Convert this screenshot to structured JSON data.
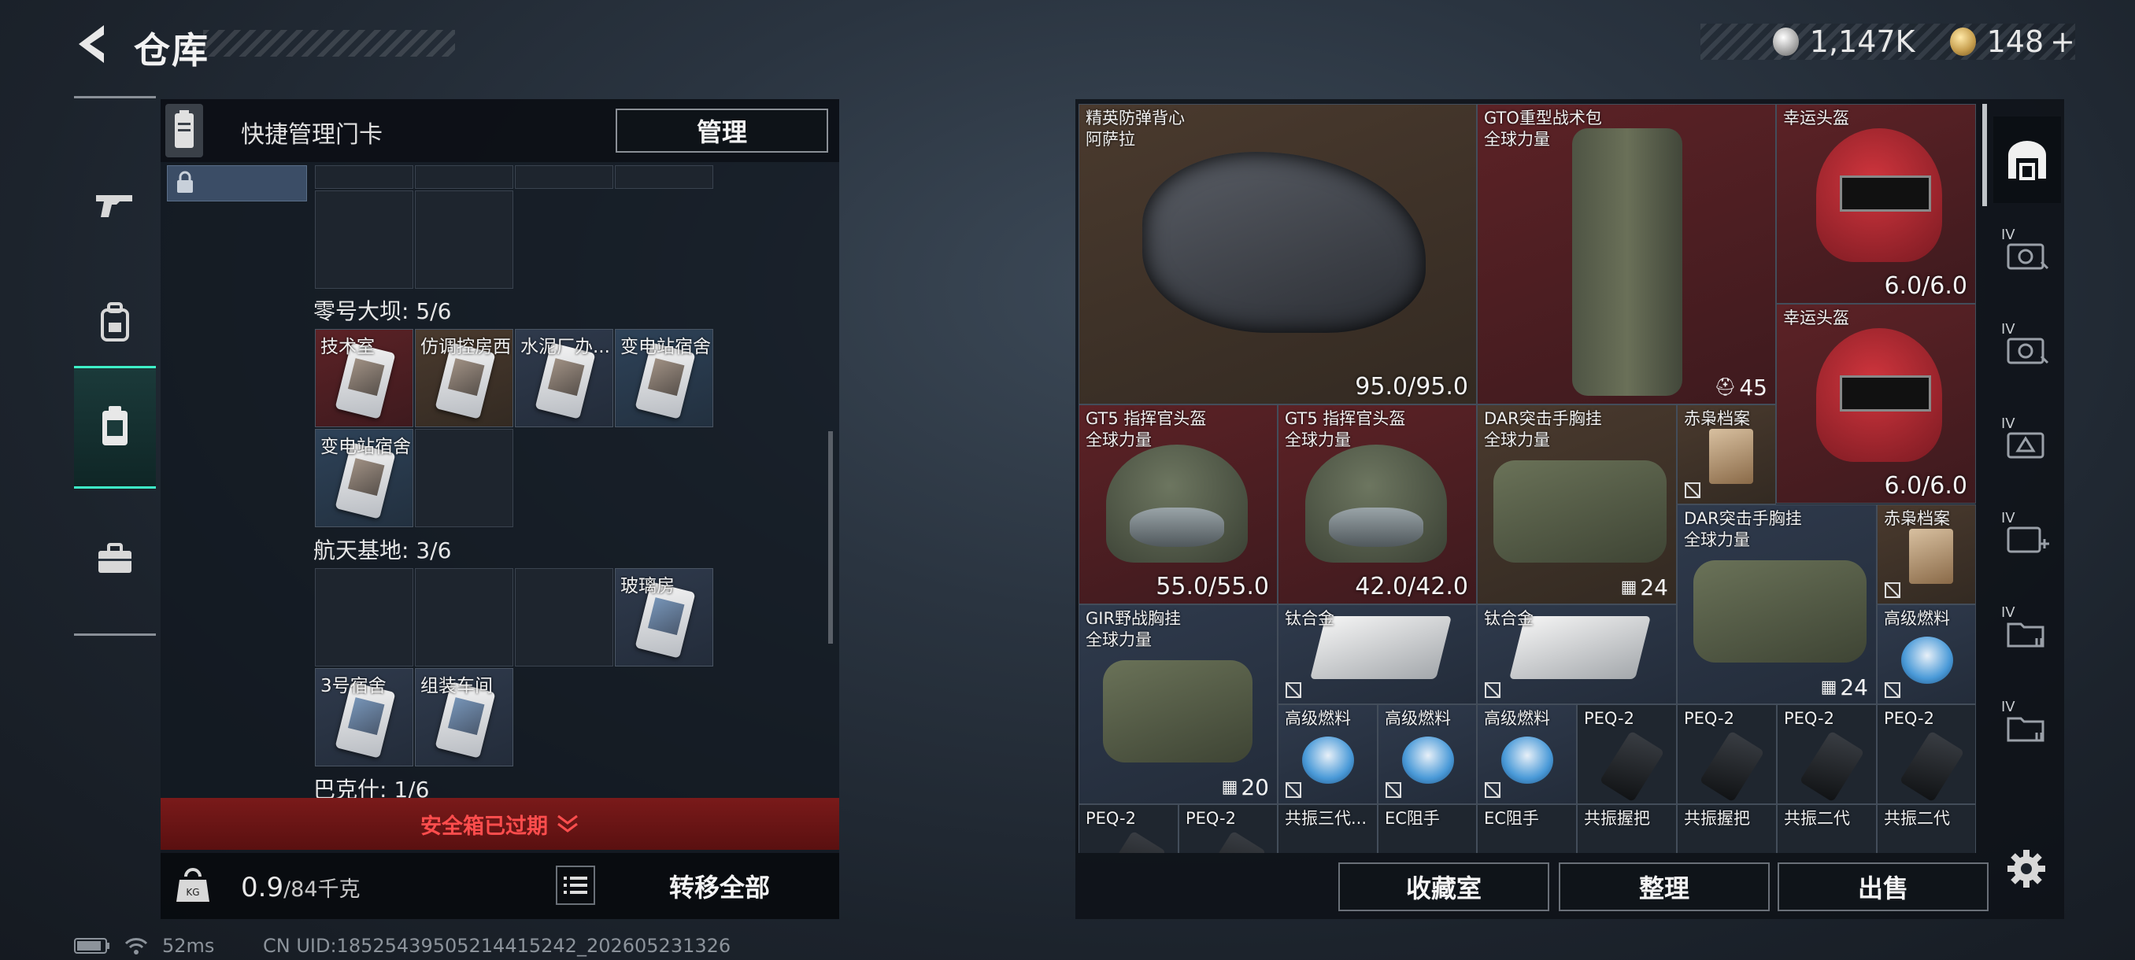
{
  "header": {
    "title": "仓库",
    "silver_amount": "1,147K",
    "gold_amount": "148",
    "gold_plus": "+"
  },
  "left_rail": {
    "tabs": [
      {
        "icon": "gun-icon"
      },
      {
        "icon": "backpack-icon"
      },
      {
        "icon": "keycard-icon",
        "active": true
      },
      {
        "icon": "briefcase-icon"
      }
    ]
  },
  "keycard_panel": {
    "title": "快捷管理门卡",
    "manage_label": "管理",
    "sections": [
      {
        "label": "零号大坝: 5/6",
        "cards": [
          {
            "name": "技术室",
            "tint": "red"
          },
          {
            "name": "仿调控房西",
            "tint": "brown"
          },
          {
            "name": "水泥厂办...",
            "tint": "slate"
          },
          {
            "name": "变电站宿舍",
            "tint": "blue"
          },
          {
            "name": "变电站宿舍",
            "tint": "blue"
          }
        ]
      },
      {
        "label": "航天基地: 3/6",
        "cards": [
          {
            "name": "玻璃房",
            "tint": "slate"
          },
          {
            "name": "3号宿舍",
            "tint": "slate"
          },
          {
            "name": "组装车间",
            "tint": "slate"
          }
        ]
      },
      {
        "label": "巴克什: 1/6"
      }
    ],
    "expired_text": "安全箱已过期",
    "weight_value": "0.9",
    "weight_max": "/84千克",
    "transfer_label": "转移全部"
  },
  "stash": {
    "items": [
      {
        "name": "精英防弹背心\n阿萨拉",
        "durability": "95.0/95.0"
      },
      {
        "name": "GTO重型战术包\n全球力量",
        "count": "45"
      },
      {
        "name": "幸运头盔",
        "durability": "6.0/6.0"
      },
      {
        "name": "幸运头盔",
        "durability": "6.0/6.0"
      },
      {
        "name": "GT5 指挥官头盔\n全球力量",
        "durability": "55.0/55.0"
      },
      {
        "name": "GT5 指挥官头盔\n全球力量",
        "durability": "42.0/42.0"
      },
      {
        "name": "DAR突击手胸挂\n全球力量",
        "count": "24"
      },
      {
        "name": "赤枭档案"
      },
      {
        "name": "DAR突击手胸挂\n全球力量",
        "count": "24"
      },
      {
        "name": "赤枭档案"
      },
      {
        "name": "GIR野战胸挂\n全球力量",
        "count": "20"
      },
      {
        "name": "钛合金"
      },
      {
        "name": "钛合金"
      },
      {
        "name": "高级燃料"
      },
      {
        "name": "高级燃料"
      },
      {
        "name": "高级燃料"
      },
      {
        "name": "高级燃料"
      },
      {
        "name": "PEQ-2"
      },
      {
        "name": "PEQ-2"
      },
      {
        "name": "PEQ-2"
      },
      {
        "name": "PEQ-2"
      },
      {
        "name": "PEQ-2"
      },
      {
        "name": "PEQ-2"
      },
      {
        "name": "共振三代..."
      },
      {
        "name": "EC阻手"
      },
      {
        "name": "EC阻手"
      },
      {
        "name": "共振握把"
      },
      {
        "name": "共振握把"
      },
      {
        "name": "共振二代"
      },
      {
        "name": "共振二代"
      }
    ],
    "buttons": {
      "collection": "收藏室",
      "organize": "整理",
      "sell": "出售"
    }
  },
  "right_rail": {
    "tabs": [
      {
        "icon": "stash-icon",
        "active": true
      },
      {
        "icon": "container-icon",
        "num": "IV"
      },
      {
        "icon": "container-icon",
        "num": "IV"
      },
      {
        "icon": "container-icon",
        "num": "IV"
      },
      {
        "icon": "add-container-icon",
        "num": "IV"
      },
      {
        "icon": "folder-icon",
        "num": "IV"
      },
      {
        "icon": "folder-icon",
        "num": "IV"
      }
    ]
  },
  "status_bar": {
    "ping": "52ms",
    "uid": "CN UID:18525439505214415242_202605231326"
  },
  "colors": {
    "accent": "#3ef0c8",
    "expired_red": "#ff4d4d",
    "rarity_red": "#5c2226",
    "rarity_slate": "#2f3a4c"
  }
}
